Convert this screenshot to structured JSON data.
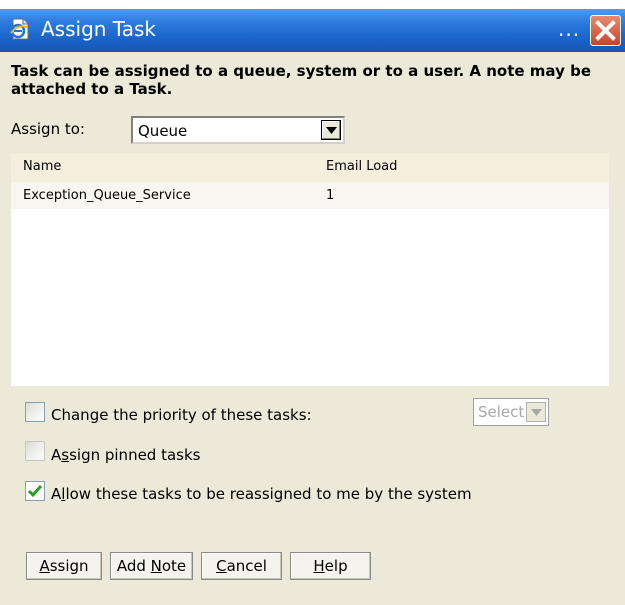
{
  "window": {
    "title": "Assign Task",
    "title_dots": "...",
    "icons": {
      "app": "ie-page-icon",
      "close": "close-x-icon"
    }
  },
  "intro": "Task can be assigned to a queue, system or to a user. A note may be attached to a Task.",
  "assign_to": {
    "label": "Assign to:",
    "selected": "Queue"
  },
  "table": {
    "columns": [
      "Name",
      "Email Load"
    ],
    "rows": [
      {
        "name": "Exception_Queue_Service",
        "email_load": "1"
      }
    ]
  },
  "options": {
    "change_priority": {
      "prefix": "Chan",
      "accel": "g",
      "suffix": "e the priority of these tasks:",
      "checked": false
    },
    "priority_select": "Select",
    "assign_pinned": {
      "prefix": "A",
      "accel": "s",
      "suffix": "sign pinned tasks",
      "checked": false
    },
    "allow_reassign": {
      "prefix": "A",
      "accel": "l",
      "suffix": "low these tasks to be reassigned to me by the system",
      "checked": true
    }
  },
  "buttons": {
    "assign": {
      "accel": "A",
      "rest": "ssign"
    },
    "add_note": {
      "prefix": "Add ",
      "accel": "N",
      "rest": "ote"
    },
    "cancel": {
      "accel": "C",
      "rest": "ancel"
    },
    "help": {
      "accel": "H",
      "rest": "elp"
    }
  },
  "colors": {
    "titlebar": "#1b63c8",
    "panel": "#ece9d8",
    "check_green": "#21a121",
    "close_red": "#c8452b"
  }
}
